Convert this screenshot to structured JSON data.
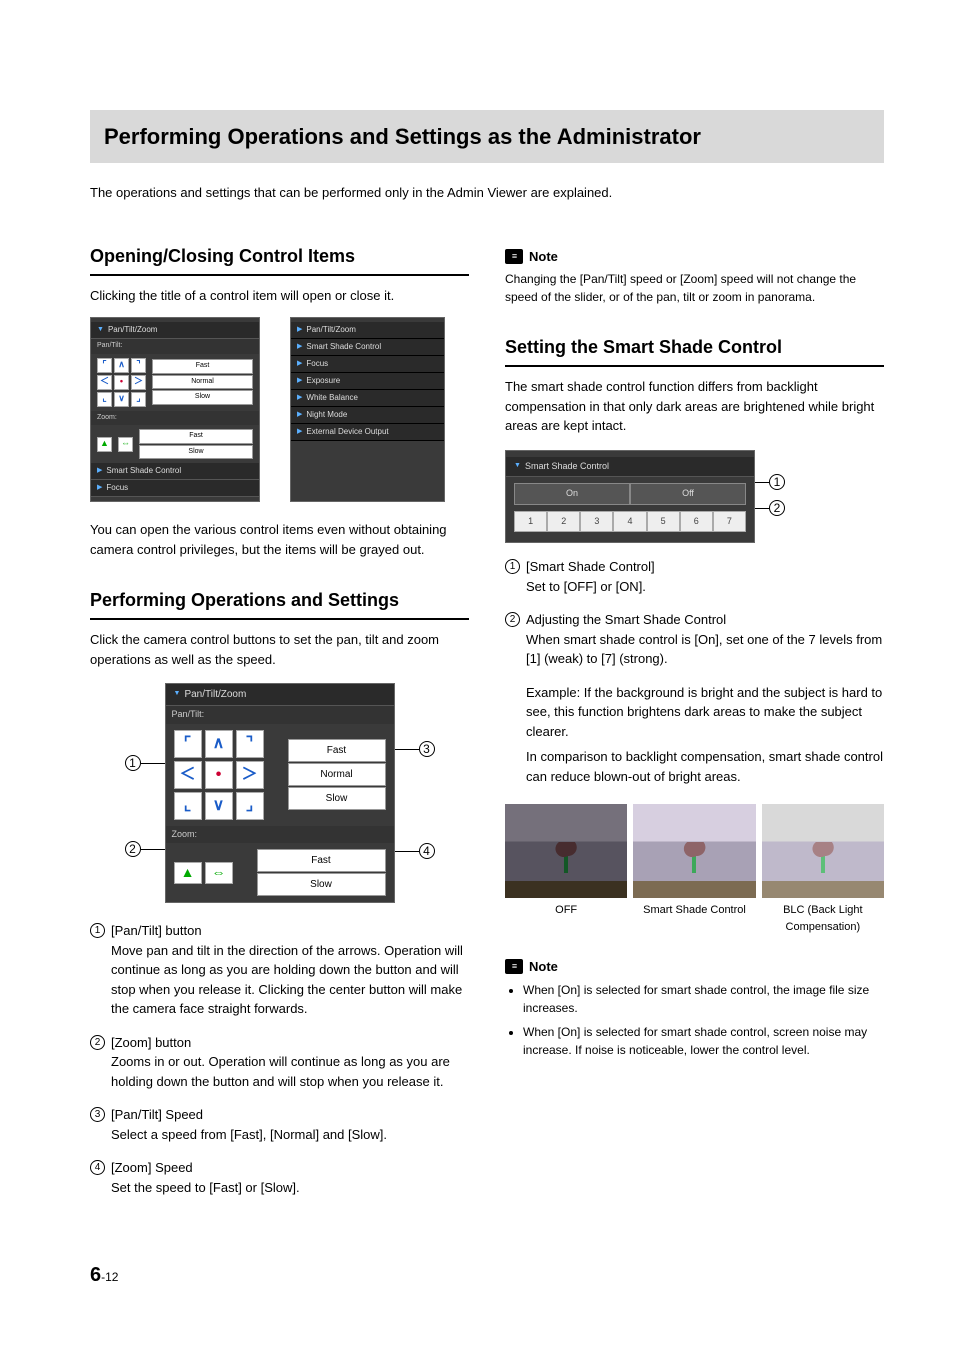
{
  "page": {
    "number_chapter": "6",
    "number_sep": "-",
    "number_page": "12"
  },
  "title": "Performing Operations and Settings as the Administrator",
  "intro": "The operations and settings that can be performed only in the Admin Viewer are explained.",
  "left": {
    "sec1_title": "Opening/Closing Control Items",
    "sec1_text": "Clicking the title of a control item will open or close it.",
    "sec1_after": "You can open the various control items even without obtaining camera control privileges, but the items will be grayed out.",
    "sec2_title": "Performing Operations and Settings",
    "sec2_text": "Click the camera control buttons to set the pan, tilt and zoom operations as well as the speed.",
    "ptz_header": "Pan/Tilt/Zoom",
    "ptz_pan_label": "Pan/Tilt:",
    "ptz_zoom_label": "Zoom:",
    "ptz_speed": {
      "fast": "Fast",
      "normal": "Normal",
      "slow": "Slow"
    },
    "collapsed_items": [
      "Pan/Tilt/Zoom",
      "Smart Shade Control",
      "Focus",
      "Exposure",
      "White Balance",
      "Night Mode",
      "External Device Output"
    ],
    "open_items_below": [
      "Smart Shade Control",
      "Focus"
    ],
    "defs": [
      {
        "n": "1",
        "title": "[Pan/Tilt] button",
        "body": "Move pan and tilt in the direction of the arrows. Operation will continue as long as you are holding down the button and will stop when you release it. Clicking the center button will make the camera face straight forwards."
      },
      {
        "n": "2",
        "title": "[Zoom] button",
        "body": "Zooms in or out. Operation will continue as long as you are holding down the button and will stop when you release it."
      },
      {
        "n": "3",
        "title": "[Pan/Tilt] Speed",
        "body": "Select a speed from [Fast], [Normal] and [Slow]."
      },
      {
        "n": "4",
        "title": "[Zoom] Speed",
        "body": "Set the speed to [Fast] or [Slow]."
      }
    ]
  },
  "right": {
    "note1_label": "Note",
    "note1_text": "Changing the [Pan/Tilt] speed or [Zoom] speed will not change the speed of the slider, or of the pan, tilt or zoom in panorama.",
    "sec3_title": "Setting the Smart Shade Control",
    "sec3_text": "The smart shade control function differs from backlight compensation in that only dark areas are brightened while bright areas are kept intact.",
    "ssc_header": "Smart Shade Control",
    "ssc_on": "On",
    "ssc_off": "Off",
    "ssc_levels": [
      "1",
      "2",
      "3",
      "4",
      "5",
      "6",
      "7"
    ],
    "ssc_defs": [
      {
        "n": "1",
        "title": "[Smart Shade Control]",
        "body": "Set to [OFF] or [ON]."
      },
      {
        "n": "2",
        "title": "Adjusting the Smart Shade Control",
        "body": "When smart shade control is [On], set one of the 7 levels from [1] (weak) to [7] (strong)."
      }
    ],
    "ssc_example1": "Example: If the background is bright and the subject is hard to see, this function brightens dark areas to make the subject clearer.",
    "ssc_example2": "In comparison to backlight compensation, smart shade control can reduce blown-out of bright areas.",
    "comp": [
      {
        "cap": "OFF",
        "kind": "dark"
      },
      {
        "cap": "Smart Shade Control",
        "kind": ""
      },
      {
        "cap": "BLC (Back Light Compensation)",
        "kind": "blc"
      }
    ],
    "note2_label": "Note",
    "note2_items": [
      "When [On] is selected for smart shade control, the image file size increases.",
      "When [On] is selected for smart shade control, screen noise may increase. If noise is noticeable, lower the control level."
    ]
  }
}
